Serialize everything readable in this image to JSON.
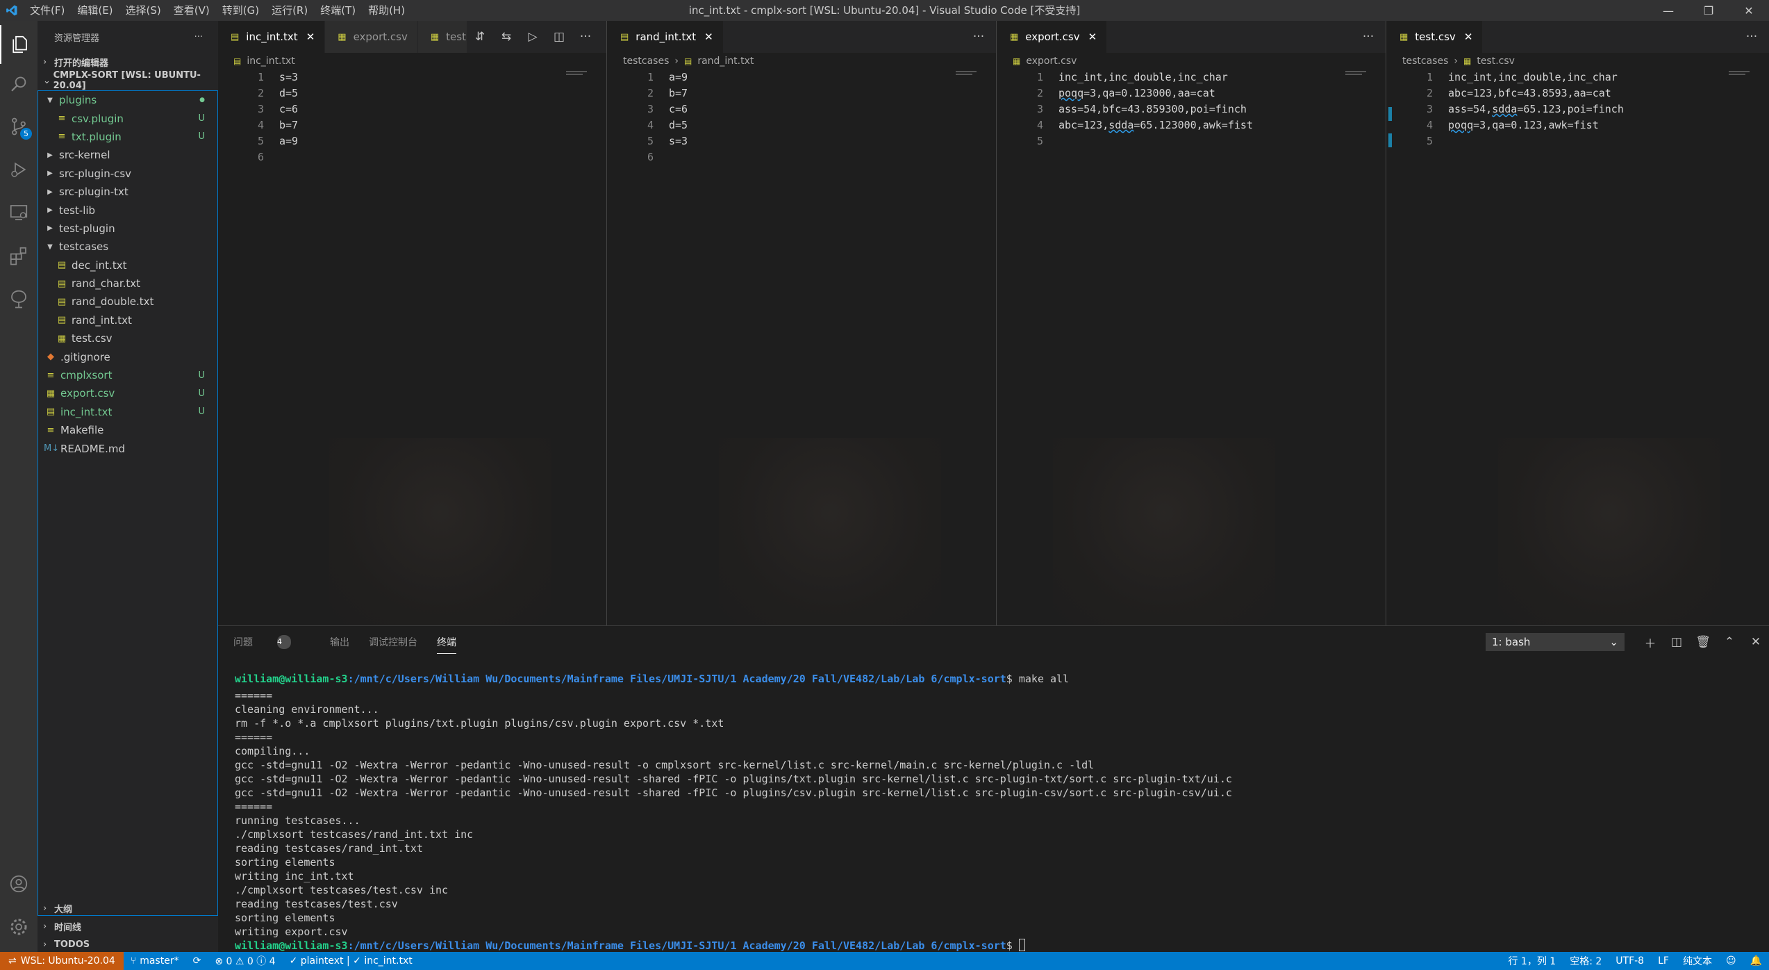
{
  "window": {
    "title": "inc_int.txt - cmplx-sort [WSL: Ubuntu-20.04] - Visual Studio Code [不受支持]",
    "menu": [
      "文件(F)",
      "编辑(E)",
      "选择(S)",
      "查看(V)",
      "转到(G)",
      "运行(R)",
      "终端(T)",
      "帮助(H)"
    ]
  },
  "activity": {
    "scm_badge": "5"
  },
  "sidebar": {
    "header": "资源管理器",
    "open_editors": "打开的编辑器",
    "folder": "CMPLX-SORT [WSL: UBUNTU-20.04]",
    "tree": [
      {
        "label": "plugins",
        "kind": "folder-open",
        "status": "●",
        "green": true,
        "indent": 0
      },
      {
        "label": "csv.plugin",
        "kind": "file",
        "icon": "≡",
        "status": "U",
        "green": true,
        "indent": 1
      },
      {
        "label": "txt.plugin",
        "kind": "file",
        "icon": "≡",
        "status": "U",
        "green": true,
        "indent": 1
      },
      {
        "label": "src-kernel",
        "kind": "folder",
        "indent": 0
      },
      {
        "label": "src-plugin-csv",
        "kind": "folder",
        "indent": 0
      },
      {
        "label": "src-plugin-txt",
        "kind": "folder",
        "indent": 0
      },
      {
        "label": "test-lib",
        "kind": "folder",
        "indent": 0
      },
      {
        "label": "test-plugin",
        "kind": "folder",
        "indent": 0
      },
      {
        "label": "testcases",
        "kind": "folder-open",
        "indent": 0
      },
      {
        "label": "dec_int.txt",
        "kind": "file",
        "icon": "▤",
        "indent": 1
      },
      {
        "label": "rand_char.txt",
        "kind": "file",
        "icon": "▤",
        "indent": 1
      },
      {
        "label": "rand_double.txt",
        "kind": "file",
        "icon": "▤",
        "indent": 1
      },
      {
        "label": "rand_int.txt",
        "kind": "file",
        "icon": "▤",
        "indent": 1
      },
      {
        "label": "test.csv",
        "kind": "file",
        "icon": "▦",
        "indent": 1
      },
      {
        "label": ".gitignore",
        "kind": "rootfile",
        "icon": "◆",
        "indent": 0
      },
      {
        "label": "cmplxsort",
        "kind": "rootfile",
        "icon": "≡",
        "status": "U",
        "green": true,
        "indent": 0
      },
      {
        "label": "export.csv",
        "kind": "rootfile",
        "icon": "▦",
        "status": "U",
        "green": true,
        "indent": 0
      },
      {
        "label": "inc_int.txt",
        "kind": "rootfile",
        "icon": "▤",
        "status": "U",
        "green": true,
        "indent": 0
      },
      {
        "label": "Makefile",
        "kind": "rootfile",
        "icon": "≡",
        "indent": 0
      },
      {
        "label": "README.md",
        "kind": "rootfile",
        "icon": "M↓",
        "indent": 0
      }
    ],
    "outline": "大纲",
    "timeline": "时间线",
    "todos": "TODOS"
  },
  "groups": [
    {
      "tabs": [
        {
          "label": "inc_int.txt",
          "icon": "▤",
          "active": true,
          "close": "✕"
        },
        {
          "label": "export.csv",
          "icon": "▦",
          "active": false
        },
        {
          "label": "test.",
          "icon": "▦",
          "active": false
        }
      ],
      "crumb": [
        "inc_int.txt"
      ],
      "lines": [
        "s=3",
        "d=5",
        "c=6",
        "b=7",
        "a=9",
        ""
      ]
    },
    {
      "tabs": [
        {
          "label": "rand_int.txt",
          "icon": "▤",
          "active": true,
          "close": "✕"
        }
      ],
      "crumb": [
        "testcases",
        "rand_int.txt"
      ],
      "lines": [
        "a=9",
        "b=7",
        "c=6",
        "d=5",
        "s=3",
        ""
      ]
    },
    {
      "tabs": [
        {
          "label": "export.csv",
          "icon": "▦",
          "active": true,
          "close": "✕"
        }
      ],
      "crumb": [
        "export.csv"
      ],
      "lines": [
        "inc_int,inc_double,inc_char",
        "poqq=3,qa=0.123000,aa=cat",
        "ass=54,bfc=43.859300,poi=finch",
        "abc=123,sdda=65.123000,awk=fist",
        ""
      ]
    },
    {
      "tabs": [
        {
          "label": "test.csv",
          "icon": "▦",
          "active": true,
          "close": "✕"
        }
      ],
      "crumb": [
        "testcases",
        "test.csv"
      ],
      "lines": [
        "inc_int,inc_double,inc_char",
        "abc=123,bfc=43.8593,aa=cat",
        "ass=54,sdda=65.123,poi=finch",
        "poqq=3,qa=0.123,awk=fist",
        ""
      ]
    }
  ],
  "panel": {
    "tabs": [
      "问题",
      "输出",
      "调试控制台",
      "终端"
    ],
    "problems_count": "4",
    "terminal_select": "1: bash",
    "prompt_user": "william@william-s3",
    "prompt_path": ":/mnt/c/Users/William Wu/Documents/Mainframe Files/UMJI-SJTU/1 Academy/20 Fall/VE482/Lab/Lab 6/cmplx-sort",
    "command": "$ make all",
    "output": [
      "======",
      "cleaning environment...",
      "rm -f *.o *.a cmplxsort plugins/txt.plugin plugins/csv.plugin export.csv *.txt",
      "======",
      "compiling...",
      "gcc -std=gnu11 -O2 -Wextra -Werror -pedantic -Wno-unused-result -o cmplxsort src-kernel/list.c src-kernel/main.c src-kernel/plugin.c -ldl",
      "gcc -std=gnu11 -O2 -Wextra -Werror -pedantic -Wno-unused-result -shared -fPIC -o plugins/txt.plugin src-kernel/list.c src-plugin-txt/sort.c src-plugin-txt/ui.c",
      "gcc -std=gnu11 -O2 -Wextra -Werror -pedantic -Wno-unused-result -shared -fPIC -o plugins/csv.plugin src-kernel/list.c src-plugin-csv/sort.c src-plugin-csv/ui.c",
      "======",
      "running testcases...",
      "./cmplxsort testcases/rand_int.txt inc",
      "reading testcases/rand_int.txt",
      "sorting elements",
      "writing inc_int.txt",
      "./cmplxsort testcases/test.csv inc",
      "reading testcases/test.csv",
      "sorting elements",
      "writing export.csv"
    ],
    "final_prompt_suffix": "$ "
  },
  "status": {
    "remote": "WSL: Ubuntu-20.04",
    "branch": "master*",
    "problems": "⊗ 0 ⚠ 0 ⓘ 4",
    "lang_check": "✓ plaintext | ✓ inc_int.txt",
    "position": "行 1，列 1",
    "spaces": "空格: 2",
    "encoding": "UTF-8",
    "eol": "LF",
    "mode": "纯文本"
  },
  "colors": {
    "accent": "#007acc",
    "remote": "#c5590f",
    "untracked": "#73c991",
    "prompt_user": "#23d18b",
    "prompt_path": "#3b8eea"
  }
}
